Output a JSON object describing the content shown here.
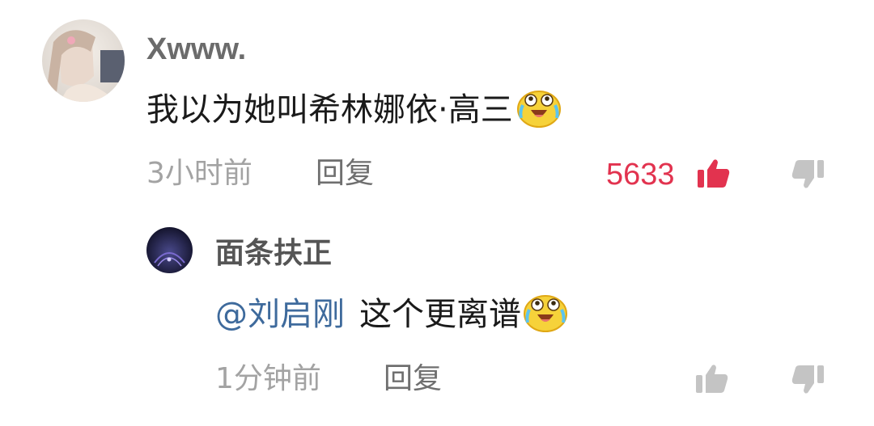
{
  "comment": {
    "username": "Xwww.",
    "text": "我以为她叫希林娜依·高三",
    "emoji": "crying-laughing-emoji",
    "time": "3小时前",
    "reply_label": "回复",
    "like_count": "5633",
    "like_icon": "thumbs-up-icon",
    "dislike_icon": "thumbs-down-icon",
    "colors": {
      "like_active": "#e2334f",
      "meta": "#a3a3a3",
      "dislike": "#c4c4c4"
    }
  },
  "reply": {
    "username": "面条扶正",
    "mention": "@刘启刚",
    "text": "这个更离谱",
    "emoji": "crying-laughing-emoji",
    "time": "1分钟前",
    "reply_label": "回复",
    "like_icon": "thumbs-up-icon",
    "dislike_icon": "thumbs-down-icon",
    "colors": {
      "mention": "#3e6a9c",
      "icon_idle": "#c4c4c4"
    }
  }
}
